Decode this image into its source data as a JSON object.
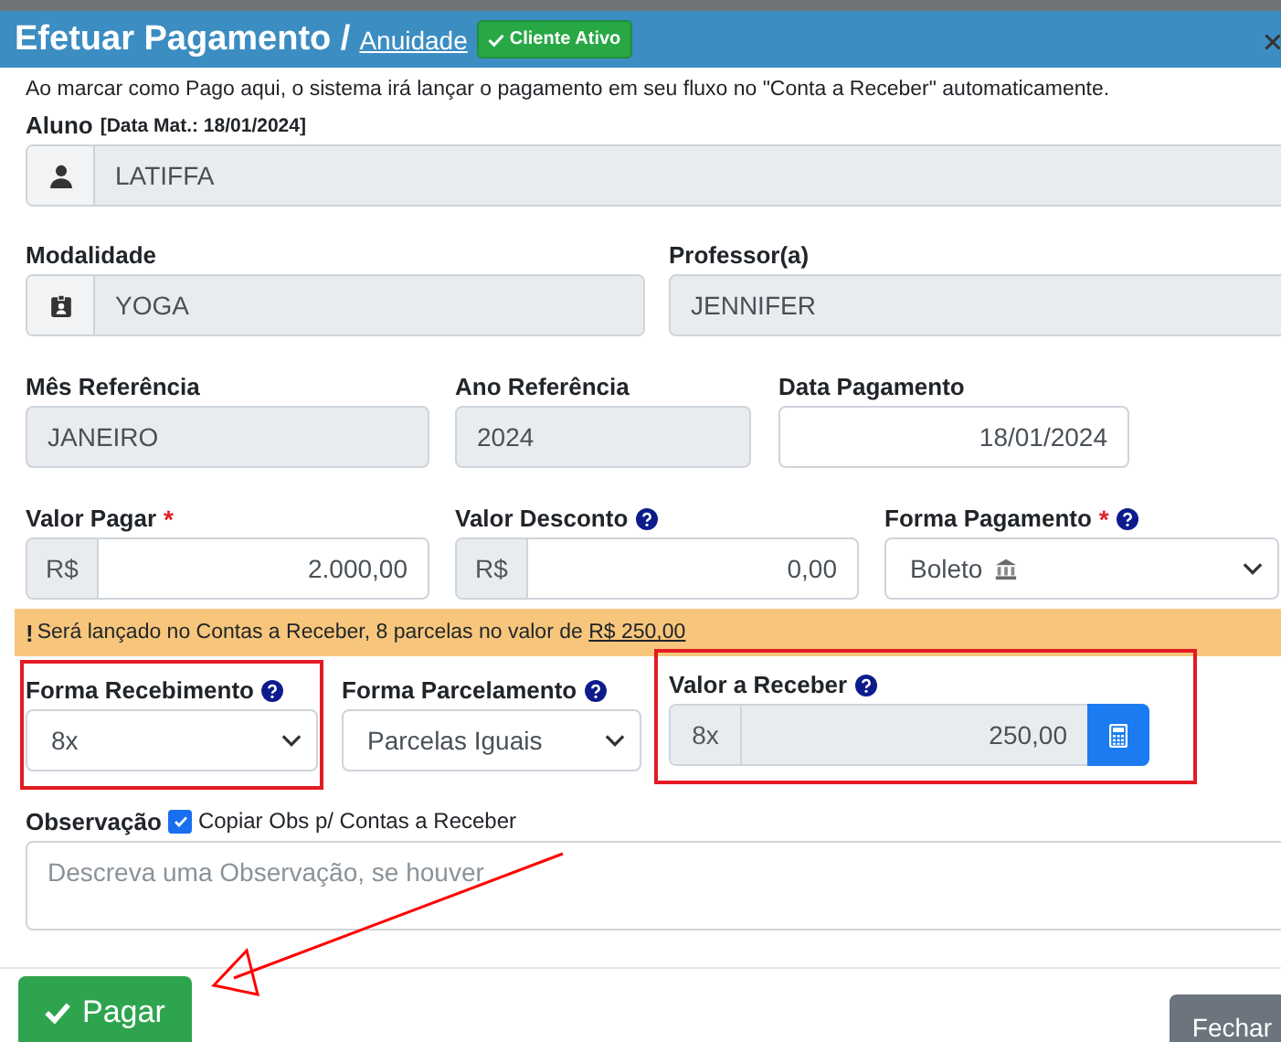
{
  "header": {
    "title": "Efetuar Pagamento /",
    "link": "Anuidade",
    "badge": "Cliente Ativo"
  },
  "notice": "Ao marcar como Pago aqui, o sistema irá lançar o pagamento em seu fluxo no \"Conta a Receber\" automaticamente.",
  "aluno": {
    "label": "Aluno",
    "note": "[Data Mat.: 18/01/2024]",
    "value": "LATIFFA"
  },
  "modalidade": {
    "label": "Modalidade",
    "value": "YOGA"
  },
  "professor": {
    "label": "Professor(a)",
    "value": "JENNIFER"
  },
  "mes_referencia": {
    "label": "Mês Referência",
    "value": "JANEIRO"
  },
  "ano_referencia": {
    "label": "Ano Referência",
    "value": "2024"
  },
  "data_pagamento": {
    "label": "Data Pagamento",
    "value": "18/01/2024"
  },
  "valor_pagar": {
    "label": "Valor Pagar",
    "required_mark": "*",
    "prefix": "R$",
    "value": "2.000,00"
  },
  "valor_desconto": {
    "label": "Valor Desconto",
    "help": true,
    "prefix": "R$",
    "value": "0,00"
  },
  "forma_pagamento": {
    "label": "Forma Pagamento",
    "required_mark": "*",
    "help": true,
    "value": "Boleto"
  },
  "alert": {
    "mark": "!",
    "text": "Será lançado no Contas a Receber, 8 parcelas no valor de",
    "amount": "R$ 250,00"
  },
  "forma_recebimento": {
    "label": "Forma Recebimento",
    "help": true,
    "value": "8x",
    "highlighted": true
  },
  "forma_parcelamento": {
    "label": "Forma Parcelamento",
    "help": true,
    "value": "Parcelas Iguais",
    "highlighted": false
  },
  "valor_receber": {
    "label": "Valor a Receber",
    "help": true,
    "prefix": "8x",
    "value": "250,00",
    "highlighted": true
  },
  "observacao": {
    "label": "Observação",
    "copy_checked": true,
    "copy_label": "Copiar Obs p/ Contas a Receber",
    "placeholder": "Descreva uma Observação, se houver"
  },
  "buttons": [
    {
      "label": "Pagar",
      "kind": "primary"
    },
    {
      "label": "Fechar",
      "kind": "secondary"
    }
  ]
}
